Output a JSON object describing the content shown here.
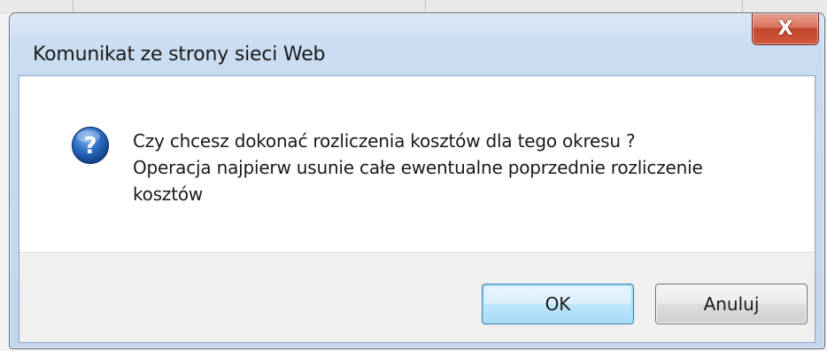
{
  "dialog": {
    "title": "Komunikat ze strony sieci Web",
    "close_icon": "close-x-icon",
    "close_glyph": "X",
    "icon": "question-icon",
    "message_lines": [
      "Czy chcesz dokonać rozliczenia kosztów dla tego okresu ?",
      "Operacja najpierw usunie całe ewentualne poprzednie rozliczenie",
      "kosztów"
    ],
    "buttons": {
      "ok_label": "OK",
      "cancel_label": "Anuluj"
    }
  },
  "colors": {
    "close_button": "#c2452c",
    "question_icon": "#1f5fb4",
    "ok_border": "#3c7fb1"
  }
}
